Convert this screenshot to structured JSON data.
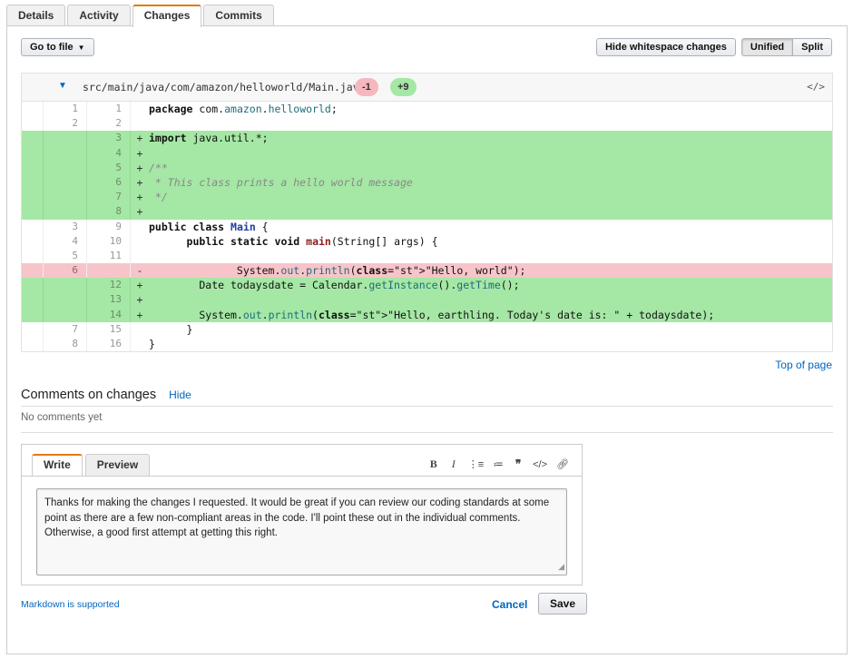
{
  "tabs": [
    "Details",
    "Activity",
    "Changes",
    "Commits"
  ],
  "active_tab": "Changes",
  "toolbar": {
    "goto_label": "Go to file",
    "hide_ws_label": "Hide whitespace changes",
    "unified_label": "Unified",
    "split_label": "Split"
  },
  "diff": {
    "file_path": "src/main/java/com/amazon/helloworld/Main.java",
    "deletions": "-1",
    "additions": "+9",
    "lines": [
      {
        "type": "ctx",
        "old": "1",
        "new": "1",
        "sign": "",
        "code": "package com.amazon.helloworld;"
      },
      {
        "type": "ctx",
        "old": "2",
        "new": "2",
        "sign": "",
        "code": ""
      },
      {
        "type": "add",
        "old": "",
        "new": "3",
        "sign": "+",
        "code": "import java.util.*;"
      },
      {
        "type": "add",
        "old": "",
        "new": "4",
        "sign": "+",
        "code": ""
      },
      {
        "type": "add",
        "old": "",
        "new": "5",
        "sign": "+",
        "code": "/**"
      },
      {
        "type": "add",
        "old": "",
        "new": "6",
        "sign": "+",
        "code": " * This class prints a hello world message"
      },
      {
        "type": "add",
        "old": "",
        "new": "7",
        "sign": "+",
        "code": " */"
      },
      {
        "type": "add",
        "old": "",
        "new": "8",
        "sign": "+",
        "code": ""
      },
      {
        "type": "ctx",
        "old": "3",
        "new": "9",
        "sign": "",
        "code": "public class Main {"
      },
      {
        "type": "ctx",
        "old": "4",
        "new": "10",
        "sign": "",
        "code": "      public static void main(String[] args) {"
      },
      {
        "type": "ctx",
        "old": "5",
        "new": "11",
        "sign": "",
        "code": ""
      },
      {
        "type": "del",
        "old": "6",
        "new": "",
        "sign": "-",
        "code": "              System.out.println(\"Hello, world\");"
      },
      {
        "type": "add",
        "old": "",
        "new": "12",
        "sign": "+",
        "code": "        Date todaysdate = Calendar.getInstance().getTime();"
      },
      {
        "type": "add",
        "old": "",
        "new": "13",
        "sign": "+",
        "code": ""
      },
      {
        "type": "add",
        "old": "",
        "new": "14",
        "sign": "+",
        "code": "        System.out.println(\"Hello, earthling. Today's date is: \" + todaysdate);"
      },
      {
        "type": "ctx",
        "old": "7",
        "new": "15",
        "sign": "",
        "code": "      }"
      },
      {
        "type": "ctx",
        "old": "8",
        "new": "16",
        "sign": "",
        "code": "}"
      }
    ]
  },
  "top_of_page": "Top of page",
  "comments": {
    "title": "Comments on changes",
    "hide_label": "Hide",
    "empty_text": "No comments yet"
  },
  "editor": {
    "write_tab": "Write",
    "preview_tab": "Preview",
    "text": "Thanks for making the changes I requested. It would be great if you can review our coding standards at some point as there are a few non-compliant areas in the code. I'll point these out in the individual comments. Otherwise, a good first attempt at getting this right."
  },
  "footer": {
    "markdown_label": "Markdown is supported",
    "cancel_label": "Cancel",
    "save_label": "Save"
  },
  "colors": {
    "accent": "#e47911",
    "link": "#0066c0",
    "add_bg": "#a5e7a5",
    "del_bg": "#f7c4c9"
  }
}
